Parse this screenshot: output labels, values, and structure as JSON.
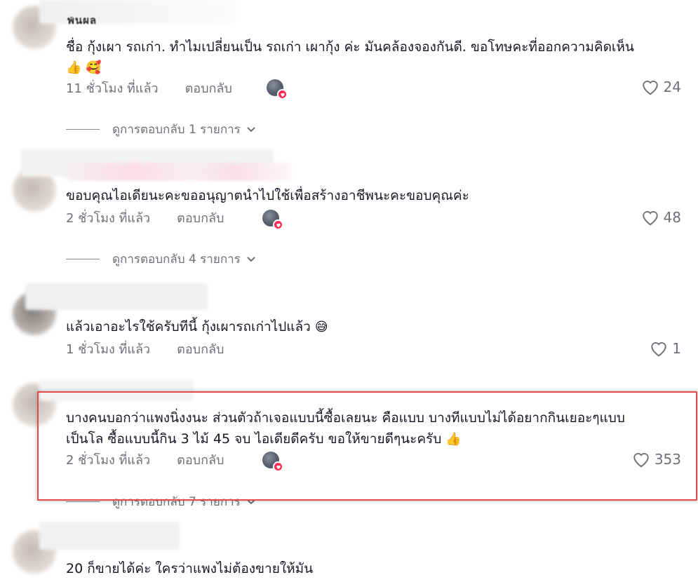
{
  "comments": [
    {
      "name_fragment": "พ้นผล",
      "text_line1": "ชื่อ กุ้งเผา รถเก่า. ทำไมเปลี่ยนเป็น รถเก่า เผากุ้ง ค่ะ มันคล้องจองกันดี. ขอโทษคะที่ออกความคิดเห็น",
      "emojis": "👍 🥰",
      "time": "11 ชั่วโมง ที่แล้ว",
      "reply_label": "ตอบกลับ",
      "likes": "24",
      "view_replies": "ดูการตอบกลับ 1 รายการ"
    },
    {
      "text_line1": "ขอบคุณไอเดียนะคะขออนุญาตนำไปใช้เพื่อสร้างอาชีพนะคะขอบคุณค่ะ",
      "time": "2 ชั่วโมง ที่แล้ว",
      "reply_label": "ตอบกลับ",
      "likes": "48",
      "view_replies": "ดูการตอบกลับ 4 รายการ"
    },
    {
      "text_line1": "แล้วเอาอะไรใช้ครับทีนี้ กุ้งเผารถเก่าไปแล้ว",
      "emojis": "😅",
      "time": "1 ชั่วโมง ที่แล้ว",
      "reply_label": "ตอบกลับ",
      "likes": "1"
    },
    {
      "text_line1": "บางคนบอกว่าแพงนิ่งงนะ ส่วนตัวถ้าเจอแบบนี้ซื้อเลยนะ คือแบบ บางทีแบบไม่ได้อยากกินเยอะๆแบบ",
      "text_line2": "เป็นโล ซื้อแบบนี้กิน 3 ไม้ 45 จบ ไอเดียดีครับ ขอให้ขายดีๆนะครับ",
      "emojis": "👍",
      "time": "2 ชั่วโมง ที่แล้ว",
      "reply_label": "ตอบกลับ",
      "likes": "353",
      "view_replies": "ดูการตอบกลับ 7 รายการ"
    },
    {
      "text_line1": "20 ก็ขายได้ค่ะ ใครว่าแพงไม่ต้องขายให้มัน"
    }
  ],
  "icons": {
    "like": "heart-outline-icon",
    "chevron": "chevron-down-icon",
    "liked_badge": "heart-badge-icon"
  },
  "colors": {
    "text": "#161823",
    "muted": "#6f7078",
    "badge": "#fe2c55",
    "highlight_border": "#e04b4b"
  }
}
